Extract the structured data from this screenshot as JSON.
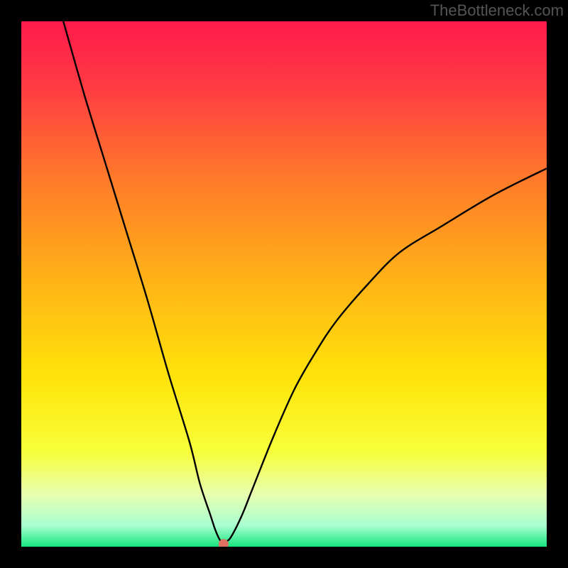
{
  "watermark": "TheBottleneck.com",
  "chart_data": {
    "type": "line",
    "title": "",
    "xlabel": "",
    "ylabel": "",
    "xlim": [
      0,
      100
    ],
    "ylim": [
      0,
      100
    ],
    "grid": false,
    "background_gradient": {
      "stops": [
        {
          "offset": 0.0,
          "color": "#ff1a4b"
        },
        {
          "offset": 0.12,
          "color": "#ff3a44"
        },
        {
          "offset": 0.3,
          "color": "#ff7a2a"
        },
        {
          "offset": 0.5,
          "color": "#ffb516"
        },
        {
          "offset": 0.68,
          "color": "#ffe40a"
        },
        {
          "offset": 0.82,
          "color": "#f7ff3a"
        },
        {
          "offset": 0.9,
          "color": "#e8ffb0"
        },
        {
          "offset": 0.96,
          "color": "#a8ffd0"
        },
        {
          "offset": 1.0,
          "color": "#17e57f"
        }
      ]
    },
    "series": [
      {
        "name": "bottleneck-curve",
        "color": "#000000",
        "x": [
          8,
          12,
          16,
          20,
          24,
          28,
          32,
          34,
          36,
          37,
          38,
          39,
          40,
          42,
          44,
          48,
          52,
          56,
          60,
          66,
          72,
          80,
          90,
          100
        ],
        "y": [
          100,
          86,
          73,
          60,
          47,
          33,
          20,
          12,
          6,
          3,
          1,
          1,
          2,
          6,
          11,
          21,
          30,
          37,
          43,
          50,
          56,
          61,
          67,
          72
        ]
      }
    ],
    "marker": {
      "name": "optimal-point",
      "x": 38.5,
      "y": 0.5,
      "color": "#e07060",
      "radius_px": 7
    }
  }
}
